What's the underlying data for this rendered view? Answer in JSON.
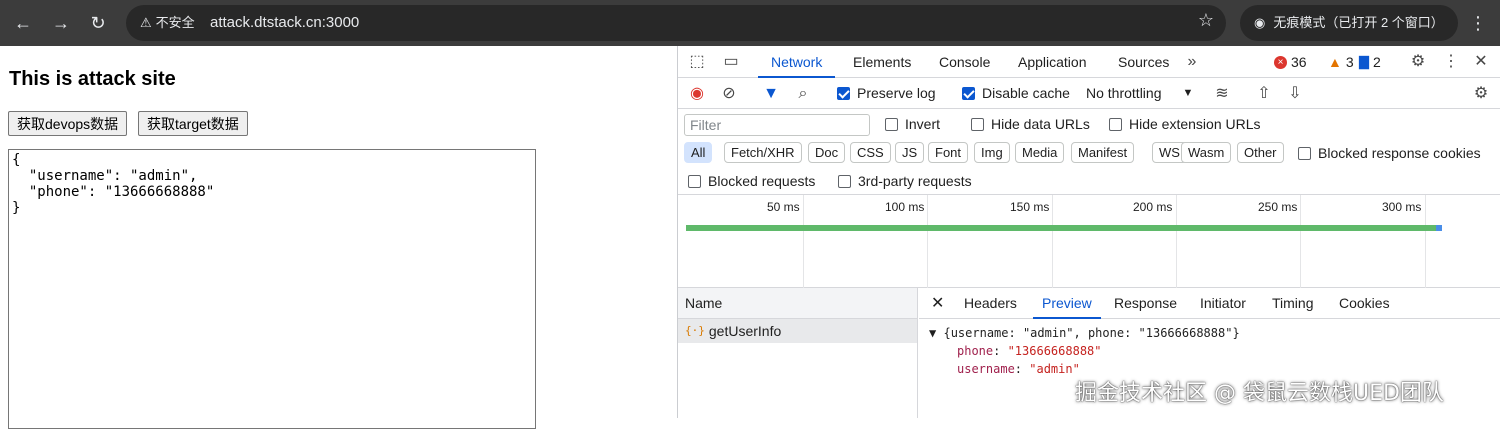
{
  "browser": {
    "back_icon": "arrow-left-icon",
    "forward_icon": "arrow-right-icon",
    "reload_icon": "reload-icon",
    "security_label": "不安全",
    "url": "attack.dtstack.cn:3000",
    "incognito_label": "无痕模式（已打开 2 个窗口）"
  },
  "page": {
    "heading": "This is attack site",
    "buttons": [
      "获取devops数据",
      "获取target数据"
    ],
    "output": "{\n  \"username\": \"admin\",\n  \"phone\": \"13666668888\"\n}"
  },
  "devtools": {
    "tabs": [
      "Network",
      "Elements",
      "Console",
      "Application",
      "Sources"
    ],
    "active_tab": "Network",
    "errors": "36",
    "warnings": "3",
    "messages": "2",
    "toolbar": {
      "preserve_log": "Preserve log",
      "disable_cache": "Disable cache",
      "throttling": "No throttling"
    },
    "filter": {
      "placeholder": "Filter",
      "invert": "Invert",
      "hide_data_urls": "Hide data URLs",
      "hide_extension_urls": "Hide extension URLs"
    },
    "types": [
      "All",
      "Fetch/XHR",
      "Doc",
      "CSS",
      "JS",
      "Font",
      "Img",
      "Media",
      "Manifest",
      "WS",
      "Wasm",
      "Other"
    ],
    "blocked_response_cookies": "Blocked response cookies",
    "blocked_requests": "Blocked requests",
    "third_party": "3rd-party requests",
    "timeline_ticks": [
      "50 ms",
      "100 ms",
      "150 ms",
      "200 ms",
      "250 ms",
      "300 ms"
    ],
    "name_header": "Name",
    "requests": [
      "getUserInfo"
    ],
    "detail_tabs": [
      "Headers",
      "Preview",
      "Response",
      "Initiator",
      "Timing",
      "Cookies"
    ],
    "active_detail_tab": "Preview",
    "preview": {
      "summary": "{username: \"admin\", phone: \"13666668888\"}",
      "phone_key": "phone",
      "phone_val": "\"13666668888\"",
      "username_key": "username",
      "username_val": "\"admin\""
    }
  },
  "watermark": "掘金技术社区 @ 袋鼠云数栈UED团队"
}
